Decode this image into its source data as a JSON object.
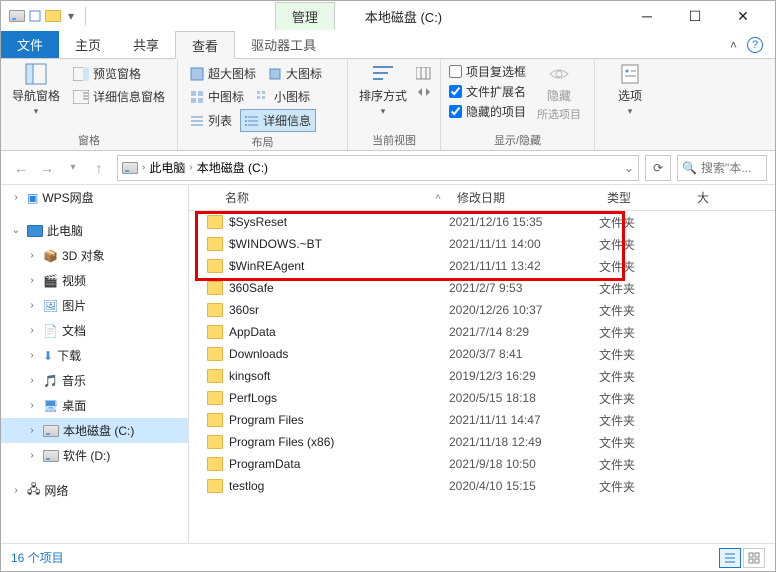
{
  "window": {
    "title": "本地磁盘 (C:)",
    "manage_tab": "管理",
    "tools_tab": "驱动器工具"
  },
  "tabs": {
    "file": "文件",
    "home": "主页",
    "share": "共享",
    "view": "查看"
  },
  "ribbon": {
    "nav_pane": "导航窗格",
    "preview_pane": "预览窗格",
    "details_pane": "详细信息窗格",
    "panes_label": "窗格",
    "xl_icons": "超大图标",
    "l_icons": "大图标",
    "m_icons": "中图标",
    "s_icons": "小图标",
    "list": "列表",
    "details": "详细信息",
    "layout_label": "布局",
    "sort": "排序方式",
    "current_label": "当前视图",
    "item_check": "项目复选框",
    "file_ext": "文件扩展名",
    "hidden_items": "隐藏的项目",
    "hide": "隐藏",
    "sel_items": "所选项目",
    "showhide_label": "显示/隐藏",
    "options": "选项"
  },
  "breadcrumb": {
    "root": "此电脑",
    "loc": "本地磁盘 (C:)"
  },
  "search": {
    "placeholder": "搜索\"本..."
  },
  "nav": {
    "wps": "WPS网盘",
    "this_pc": "此电脑",
    "items": [
      "3D 对象",
      "视频",
      "图片",
      "文档",
      "下载",
      "音乐",
      "桌面",
      "本地磁盘 (C:)",
      "软件 (D:)"
    ],
    "network": "网络"
  },
  "columns": {
    "name": "名称",
    "date": "修改日期",
    "type": "类型",
    "size": "大"
  },
  "type_folder": "文件夹",
  "files": [
    {
      "name": "$SysReset",
      "date": "2021/12/16 15:35"
    },
    {
      "name": "$WINDOWS.~BT",
      "date": "2021/11/11 14:00"
    },
    {
      "name": "$WinREAgent",
      "date": "2021/11/11 13:42"
    },
    {
      "name": "360Safe",
      "date": "2021/2/7 9:53"
    },
    {
      "name": "360sr",
      "date": "2020/12/26 10:37"
    },
    {
      "name": "AppData",
      "date": "2021/7/14 8:29"
    },
    {
      "name": "Downloads",
      "date": "2020/3/7 8:41"
    },
    {
      "name": "kingsoft",
      "date": "2019/12/3 16:29"
    },
    {
      "name": "PerfLogs",
      "date": "2020/5/15 18:18"
    },
    {
      "name": "Program Files",
      "date": "2021/11/11 14:47"
    },
    {
      "name": "Program Files (x86)",
      "date": "2021/11/18 12:49"
    },
    {
      "name": "ProgramData",
      "date": "2021/9/18 10:50"
    },
    {
      "name": "testlog",
      "date": "2020/4/10 15:15"
    }
  ],
  "status": {
    "count": "16 个项目"
  }
}
